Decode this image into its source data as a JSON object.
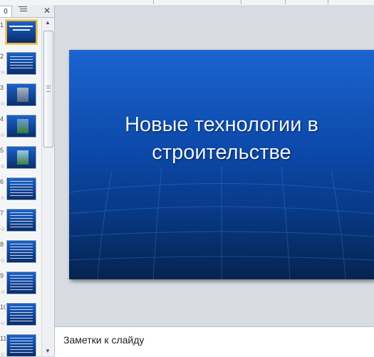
{
  "panel": {
    "tab_slides": "0",
    "tab_outline_icon": "outline-lines-icon",
    "close_symbol": "✕"
  },
  "thumbnails": [
    {
      "num": "1",
      "selected": true
    },
    {
      "num": "2"
    },
    {
      "num": "3"
    },
    {
      "num": "4"
    },
    {
      "num": "5"
    },
    {
      "num": "6"
    },
    {
      "num": "7"
    },
    {
      "num": "8"
    },
    {
      "num": "9"
    },
    {
      "num": "10"
    },
    {
      "num": "11"
    }
  ],
  "slide": {
    "title_line1": "Новые технологии в",
    "title_line2": "строительстве"
  },
  "notes": {
    "placeholder": "Заметки к слайду"
  },
  "colors": {
    "slide_top": "#1c64d0",
    "slide_bottom": "#052350",
    "selection": "#f4c65b"
  }
}
